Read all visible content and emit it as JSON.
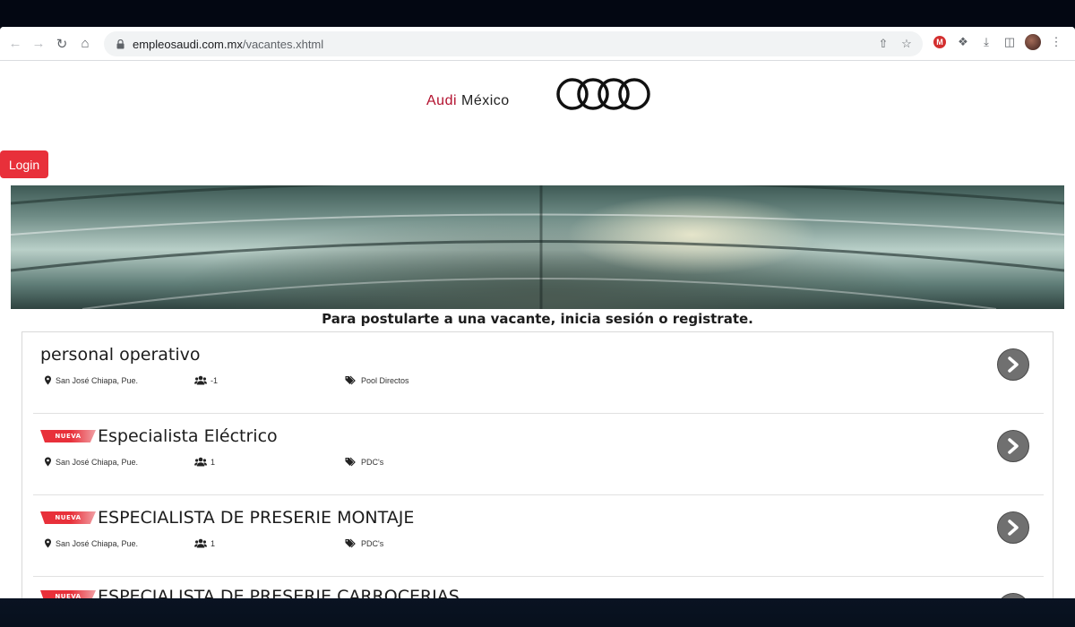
{
  "browser": {
    "url_host": "empleosaudi.com.mx",
    "url_path": "/vacantes.xhtml"
  },
  "brand": {
    "name": "Audi",
    "country": "México"
  },
  "login_label": "Login",
  "notice": "Para postularte a una vacante, inicia sesión o registrate.",
  "badge_label": "NUEVA",
  "jobs": [
    {
      "title": "personal operativo",
      "is_new": false,
      "location": "San José Chiapa, Pue.",
      "openings": "-1",
      "category": "Pool Directos"
    },
    {
      "title": "Especialista Eléctrico",
      "is_new": true,
      "location": "San José Chiapa, Pue.",
      "openings": "1",
      "category": "PDC's"
    },
    {
      "title": "ESPECIALISTA DE PRESERIE MONTAJE",
      "is_new": true,
      "location": "San José Chiapa, Pue.",
      "openings": "1",
      "category": "PDC's"
    },
    {
      "title": "ESPECIALISTA DE PRESERIE CARROCERIAS",
      "is_new": true,
      "location": "",
      "openings": "",
      "category": ""
    }
  ],
  "colors": {
    "accent": "#e8303a",
    "audi_red": "#b3112e",
    "arrow_gray": "#707070"
  }
}
